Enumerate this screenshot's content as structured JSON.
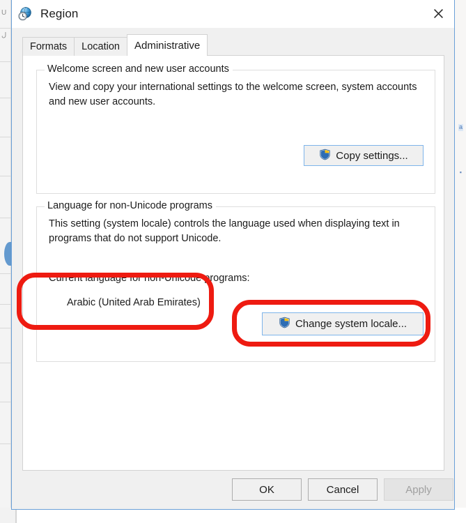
{
  "window": {
    "title": "Region",
    "icon": "region-globe-clock-icon",
    "close_label": "✕"
  },
  "tabs": [
    {
      "label": "Formats",
      "active": false
    },
    {
      "label": "Location",
      "active": false
    },
    {
      "label": "Administrative",
      "active": true
    }
  ],
  "groups": {
    "welcome": {
      "label": "Welcome screen and new user accounts",
      "description": "View and copy your international settings to the welcome screen, system accounts and new user accounts.",
      "button": {
        "label": "Copy settings...",
        "icon": "uac-shield-icon"
      }
    },
    "nonunicode": {
      "label": "Language for non-Unicode programs",
      "description": "This setting (system locale) controls the language used when displaying text in programs that do not support Unicode.",
      "current_label": "Current language for non-Unicode programs:",
      "current_value": "Arabic (United Arab Emirates)",
      "button": {
        "label": "Change system locale...",
        "icon": "uac-shield-icon"
      }
    }
  },
  "footer": {
    "ok": "OK",
    "cancel": "Cancel",
    "apply": "Apply"
  },
  "annotations": {
    "locale_value_highlight": "red-rounded-rect-highlight",
    "change_locale_highlight": "red-rounded-rect-highlight",
    "color": "#EE1B11"
  },
  "colors": {
    "window_border": "#6AA0D8",
    "button_focus_border": "#7EB4EA",
    "dialog_face": "#F0F0F0",
    "panel": "#FFFFFF",
    "text": "#1B1B1B",
    "disabled_text": "#A0A0A0",
    "shield_blue": "#2E6DB4",
    "shield_yellow": "#FFC20E"
  },
  "background_fragments": [
    {
      "text": "U"
    },
    {
      "text": "ل"
    },
    {
      "text": "a"
    },
    {
      "text": "▪"
    }
  ]
}
